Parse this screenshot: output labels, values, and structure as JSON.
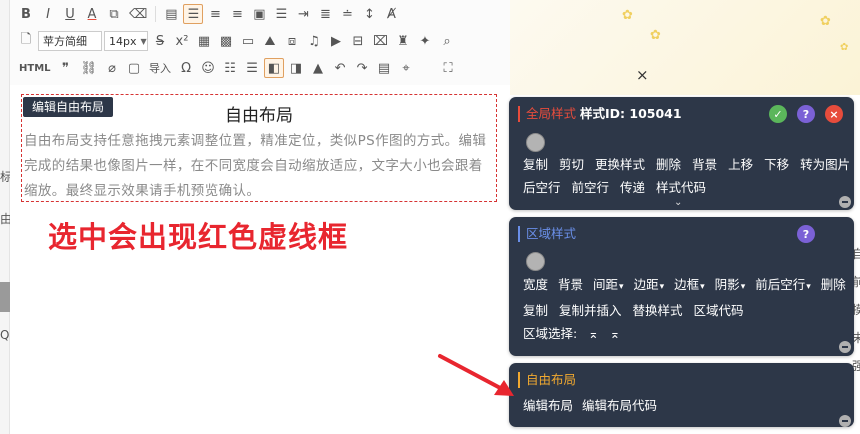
{
  "left_strip": {
    "fragments": [
      "标",
      "由",
      "Q",
      "Q"
    ]
  },
  "toolbar": {
    "font_family_value": "苹方简细",
    "font_size_value": "14px",
    "html_label": "HTML",
    "import_label": "导入",
    "symbol_icons": [
      "B",
      "I",
      "U",
      "A",
      "Tt",
      "Ab",
      "≡",
      "≡",
      "≡",
      "Ω",
      "≡",
      "≡",
      "≡",
      "≡",
      "≡",
      "↕",
      "A"
    ]
  },
  "editor": {
    "tag_label": "编辑自由布局",
    "block_title": "自由布局",
    "block_body": "自由布局支持任意拖拽元素调整位置，精准定位，类似PS作图的方式。编辑完成的结果也像图片一样，在不同宽度会自动缩放适应，文字大小也会跟着缩放。最终显示效果请手机预览确认。",
    "annotation": "选中会出现红色虚线框"
  },
  "close_symbol": "×",
  "right_edge": {
    "fragments": [
      "自",
      "前",
      "摸",
      "未",
      "强"
    ]
  },
  "global_panel": {
    "title": "全局样式",
    "style_id": "样式ID: 105041",
    "title_color": "#e74c3c",
    "row1": [
      "复制",
      "剪切",
      "更换样式",
      "删除",
      "背景",
      "上移",
      "下移",
      "转为图片"
    ],
    "row2": [
      "后空行",
      "前空行",
      "传递",
      "样式代码"
    ],
    "chevron": "⌄",
    "help_symbol": "?",
    "close_symbol": "×",
    "thumb_symbol": "👍"
  },
  "area_panel": {
    "title": "区域样式",
    "title_color": "#6a8fe8",
    "row1": [
      "宽度",
      "背景",
      "间距",
      "边距",
      "边框",
      "阴影",
      "前后空行",
      "删除"
    ],
    "row1_dropdown": [
      false,
      false,
      true,
      true,
      true,
      true,
      true,
      false
    ],
    "row2": [
      "复制",
      "复制并插入",
      "替换样式",
      "区域代码"
    ],
    "select_label": "区域选择:",
    "select_arrows": [
      "⌅",
      "⌅"
    ],
    "help_symbol": "?"
  },
  "layout_panel": {
    "title": "自由布局",
    "title_color": "#f0a830",
    "actions": [
      "编辑布局",
      "编辑布局代码"
    ]
  }
}
